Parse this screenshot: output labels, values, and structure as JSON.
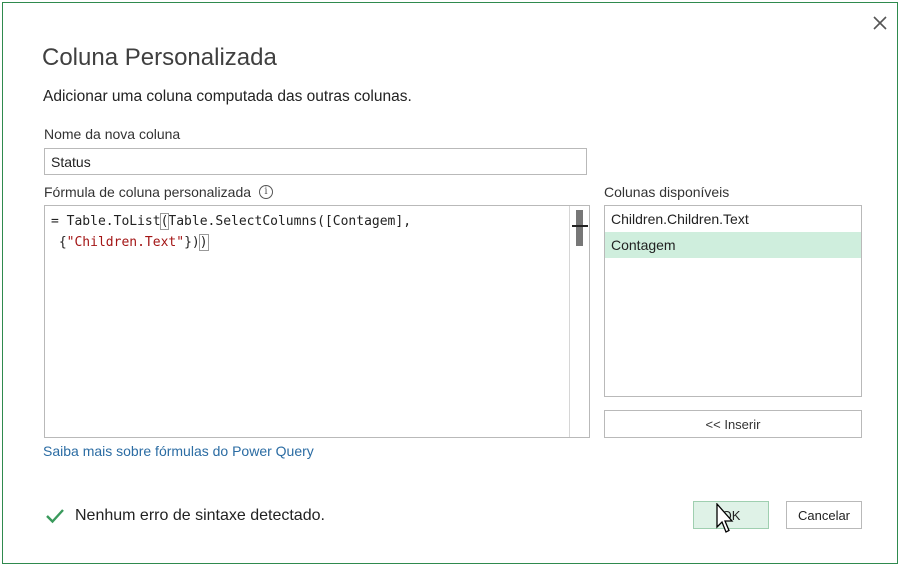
{
  "dialog": {
    "title": "Coluna Personalizada",
    "subtitle": "Adicionar uma coluna computada das outras colunas."
  },
  "name_field": {
    "label": "Nome da nova coluna",
    "value": "Status"
  },
  "formula": {
    "label": "Fórmula de coluna personalizada",
    "line1_prefix": "= Table.ToList",
    "line1_bracket": "(",
    "line1_rest": "Table.SelectColumns([Contagem],",
    "line2_prefix": " {",
    "line2_string": "\"Children.Text\"",
    "line2_mid": "})",
    "line2_bracket": ")"
  },
  "columns": {
    "label": "Colunas disponíveis",
    "items": [
      {
        "label": "Children.Children.Text",
        "selected": false
      },
      {
        "label": "Contagem",
        "selected": true
      }
    ],
    "insert_label": "<< Inserir"
  },
  "learn_link": "Saiba mais sobre fórmulas do Power Query",
  "status": {
    "text": "Nenhum erro de sintaxe detectado.",
    "icon": "checkmark-icon",
    "color": "#3a9a5c"
  },
  "buttons": {
    "ok": "OK",
    "cancel": "Cancelar"
  },
  "colors": {
    "accent": "#2f8a4e",
    "selected_row": "#cfeedd",
    "link": "#2b6ca3",
    "string_literal": "#a31515"
  }
}
